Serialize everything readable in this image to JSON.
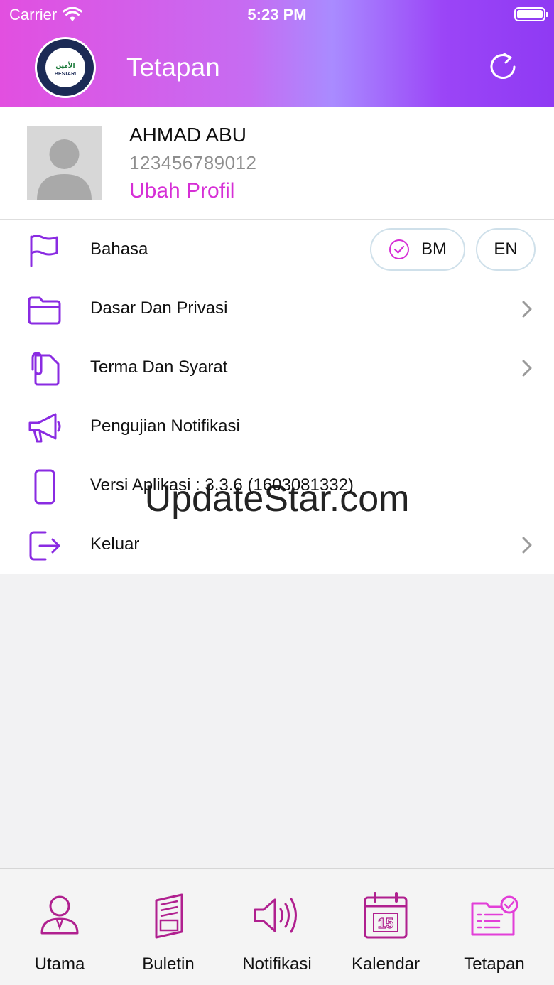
{
  "status_bar": {
    "carrier": "Carrier",
    "time": "5:23 PM"
  },
  "header": {
    "title": "Tetapan",
    "logo_text": "الأمين",
    "logo_subtext": "BESTARI"
  },
  "profile": {
    "name": "AHMAD ABU",
    "id_number": "123456789012",
    "edit_label": "Ubah Profil"
  },
  "menu": {
    "language": {
      "label": "Bahasa",
      "options": [
        "BM",
        "EN"
      ],
      "selected": "BM"
    },
    "items": [
      {
        "label": "Dasar Dan Privasi"
      },
      {
        "label": "Terma Dan Syarat"
      },
      {
        "label": "Pengujian Notifikasi"
      },
      {
        "label": "Versi Aplikasi : 3.3.6 (1603081332)"
      },
      {
        "label": "Keluar"
      }
    ]
  },
  "watermark": "UpdateStar.com",
  "tabs": [
    {
      "label": "Utama",
      "icon": "user-icon"
    },
    {
      "label": "Buletin",
      "icon": "newspaper-icon"
    },
    {
      "label": "Notifikasi",
      "icon": "speaker-icon"
    },
    {
      "label": "Kalendar",
      "icon": "calendar-icon",
      "day": "15"
    },
    {
      "label": "Tetapan",
      "icon": "settings-folder-icon"
    }
  ],
  "colors": {
    "accent": "#d62fd6",
    "icon_purple": "#8a2be2",
    "tab_icon": "#b0208f"
  }
}
